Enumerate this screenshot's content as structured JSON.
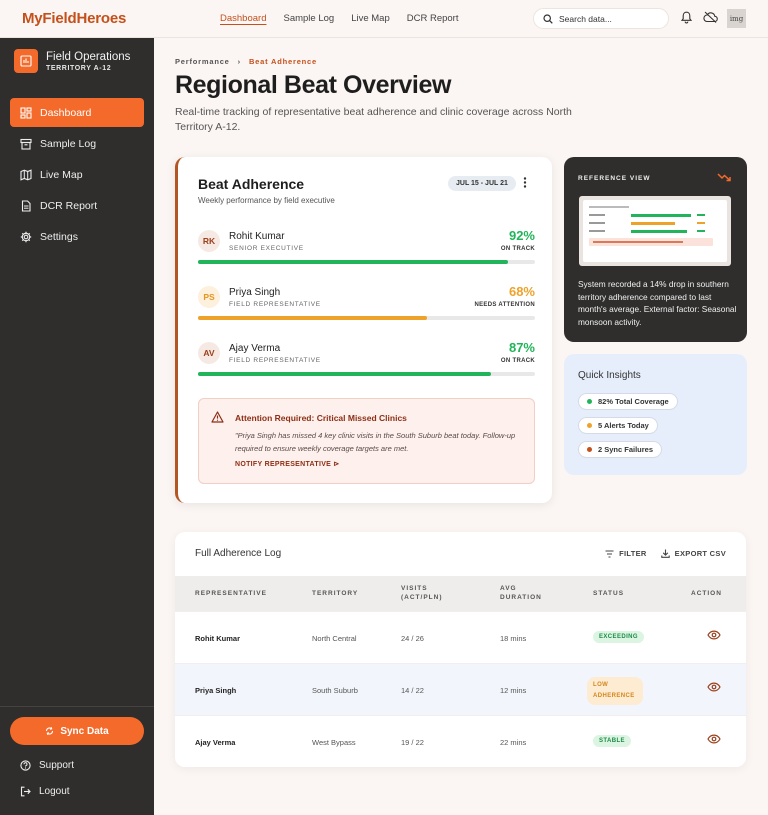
{
  "app": {
    "brand": "MyFieldHeroes"
  },
  "topnav": {
    "items": [
      "Dashboard",
      "Sample Log",
      "Live Map",
      "DCR Report"
    ],
    "active": "Dashboard"
  },
  "search": {
    "placeholder": "Search data..."
  },
  "avatar": {
    "label": "img"
  },
  "sidebar": {
    "workspace_title": "Field Operations",
    "workspace_subtitle": "TERRITORY A-12",
    "items": [
      {
        "label": "Dashboard",
        "icon": "dashboard-icon",
        "active": true
      },
      {
        "label": "Sample Log",
        "icon": "archive-icon"
      },
      {
        "label": "Live Map",
        "icon": "map-icon"
      },
      {
        "label": "DCR Report",
        "icon": "document-icon"
      },
      {
        "label": "Settings",
        "icon": "gear-icon"
      }
    ],
    "sync_label": "Sync Data",
    "support_label": "Support",
    "logout_label": "Logout"
  },
  "breadcrumb": {
    "parent": "Performance",
    "current": "Beat Adherence"
  },
  "page": {
    "title": "Regional Beat Overview",
    "description": "Real-time tracking of representative beat adherence and clinic coverage across North Territory A-12."
  },
  "beat_card": {
    "title": "Beat Adherence",
    "subtitle": "Weekly performance by field executive",
    "date_range": "JUL 15 - JUL 21",
    "reps": [
      {
        "initials": "RK",
        "name": "Rohit Kumar",
        "role": "SENIOR EXECUTIVE",
        "percent": "92%",
        "fill": 0.92,
        "status": "ON TRACK",
        "color": "#22b45a"
      },
      {
        "initials": "PS",
        "name": "Priya Singh",
        "role": "FIELD REPRESENTATIVE",
        "percent": "68%",
        "fill": 0.68,
        "status": "NEEDS ATTENTION",
        "color": "#eea22a"
      },
      {
        "initials": "AV",
        "name": "Ajay Verma",
        "role": "FIELD REPRESENTATIVE",
        "percent": "87%",
        "fill": 0.87,
        "status": "ON TRACK",
        "color": "#22b45a"
      }
    ],
    "alert": {
      "title": "Attention Required: Critical Missed Clinics",
      "body": "\"Priya Singh has missed 4 key clinic visits in the South Suburb beat today. Follow-up required to ensure weekly coverage targets are met.",
      "link": "NOTIFY REPRESENTATIVE"
    }
  },
  "reference": {
    "label": "REFERENCE VIEW",
    "text": "System recorded a 14% drop in southern territory adherence compared to last month's average. External factor: Seasonal monsoon activity."
  },
  "insights": {
    "title": "Quick Insights",
    "items": [
      {
        "label": "82% Total Coverage",
        "color": "#22b45a"
      },
      {
        "label": "5 Alerts Today",
        "color": "#eea22a"
      },
      {
        "label": "2 Sync Failures",
        "color": "#c4501b"
      }
    ]
  },
  "log": {
    "title": "Full Adherence Log",
    "filter_label": "FILTER",
    "export_label": "EXPORT CSV",
    "headers": [
      "REPRESENTATIVE",
      "TERRITORY",
      "VISITS\n(ACT/PLN)",
      "AVG\nDURATION",
      "STATUS",
      "ACTION"
    ],
    "rows": [
      {
        "name": "Rohit Kumar",
        "territory": "North Central",
        "visits": "24 / 26",
        "duration": "18 mins",
        "status": "EXCEEDING",
        "status_bg": "#dcf5e3",
        "status_fg": "#1d8a45"
      },
      {
        "name": "Priya Singh",
        "territory": "South Suburb",
        "visits": "14 / 22",
        "duration": "12 mins",
        "status": "LOW ADHERENCE",
        "status_bg": "#fdebd2",
        "status_fg": "#d6861a"
      },
      {
        "name": "Ajay Verma",
        "territory": "West Bypass",
        "visits": "19 / 22",
        "duration": "22 mins",
        "status": "STABLE",
        "status_bg": "#dcf5e3",
        "status_fg": "#1d8a45"
      }
    ]
  }
}
